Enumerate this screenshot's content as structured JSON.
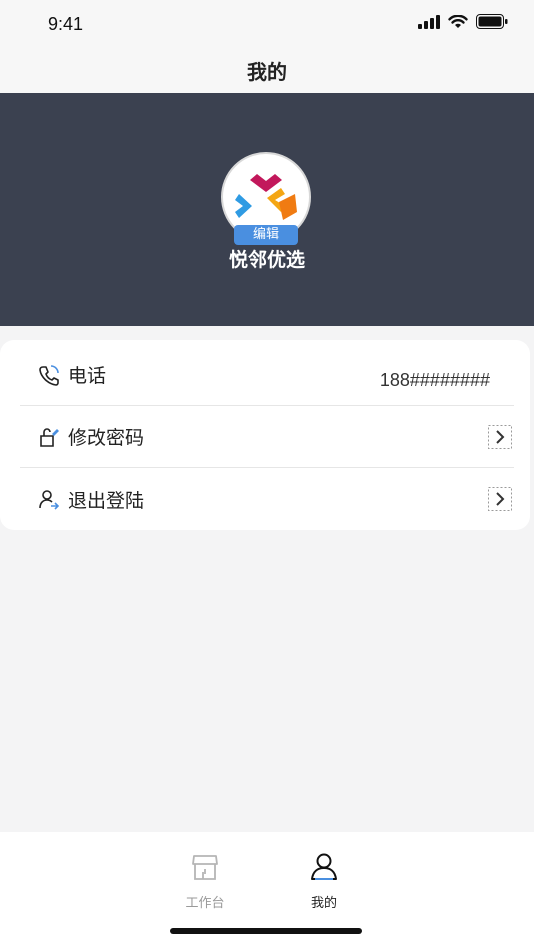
{
  "status_bar": {
    "time": "9:41",
    "icons": [
      "signal-icon",
      "wifi-icon",
      "battery-icon"
    ]
  },
  "nav": {
    "title": "我的"
  },
  "profile": {
    "edit_label": "编辑",
    "shop_name": "悦邻优选",
    "header_color": "#3b4150"
  },
  "menu": {
    "phone": {
      "label": "电话",
      "value": "188########",
      "icon": "phone-icon"
    },
    "change_password": {
      "label": "修改密码",
      "icon": "lock-edit-icon"
    },
    "logout": {
      "label": "退出登陆",
      "icon": "user-logout-icon"
    }
  },
  "tabs": [
    {
      "label": "工作台",
      "icon": "shop-icon",
      "active": false
    },
    {
      "label": "我的",
      "icon": "user-icon",
      "active": true
    }
  ],
  "colors": {
    "accent": "#4a8fe0",
    "inactive": "#9a9a9a",
    "active": "#222222"
  }
}
